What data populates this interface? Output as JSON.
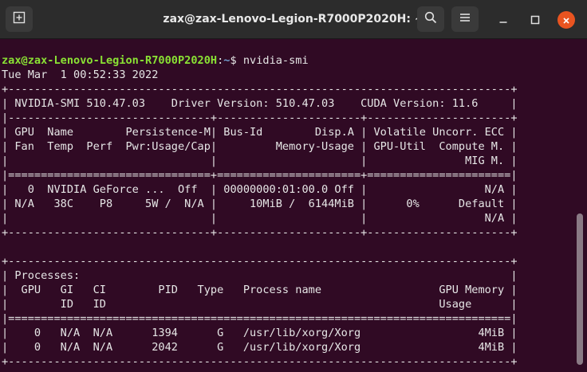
{
  "window": {
    "title": "zax@zax-Lenovo-Legion-R7000P2020H: ~"
  },
  "terminal": {
    "prompt_user": "zax@zax-Lenovo-Legion-R7000P2020H",
    "prompt_sep": ":",
    "prompt_path": "~",
    "prompt_symbol": "$ ",
    "command": "nvidia-smi",
    "lines": [
      "Tue Mar  1 00:52:33 2022",
      "+-----------------------------------------------------------------------------+",
      "| NVIDIA-SMI 510.47.03    Driver Version: 510.47.03    CUDA Version: 11.6     |",
      "|-------------------------------+----------------------+----------------------+",
      "| GPU  Name        Persistence-M| Bus-Id        Disp.A | Volatile Uncorr. ECC |",
      "| Fan  Temp  Perf  Pwr:Usage/Cap|         Memory-Usage | GPU-Util  Compute M. |",
      "|                               |                      |               MIG M. |",
      "|===============================+======================+======================|",
      "|   0  NVIDIA GeForce ...  Off  | 00000000:01:00.0 Off |                  N/A |",
      "| N/A   38C    P8     5W /  N/A |     10MiB /  6144MiB |      0%      Default |",
      "|                               |                      |                  N/A |",
      "+-------------------------------+----------------------+----------------------+",
      "",
      "+-----------------------------------------------------------------------------+",
      "| Processes:                                                                  |",
      "|  GPU   GI   CI        PID   Type   Process name                  GPU Memory |",
      "|        ID   ID                                                   Usage      |",
      "|=============================================================================|",
      "|    0   N/A  N/A      1394      G   /usr/lib/xorg/Xorg                  4MiB |",
      "|    0   N/A  N/A      2042      G   /usr/lib/xorg/Xorg                  4MiB |",
      "+-----------------------------------------------------------------------------+"
    ]
  }
}
